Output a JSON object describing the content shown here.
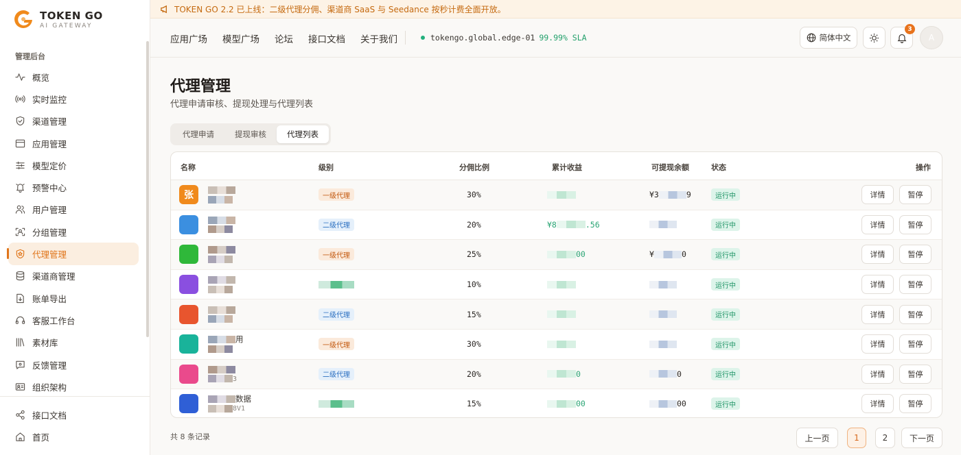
{
  "brand": {
    "title": "TOKEN GO",
    "subtitle": "AI GATEWAY"
  },
  "sidebar": {
    "section_label": "管理后台",
    "items": [
      {
        "label": "概览",
        "icon": "activity-icon"
      },
      {
        "label": "实时监控",
        "icon": "broadcast-icon"
      },
      {
        "label": "渠道管理",
        "icon": "shield-icon"
      },
      {
        "label": "应用管理",
        "icon": "window-icon"
      },
      {
        "label": "模型定价",
        "icon": "sliders-icon"
      },
      {
        "label": "预警中心",
        "icon": "bell-icon"
      },
      {
        "label": "用户管理",
        "icon": "users-icon"
      },
      {
        "label": "分组管理",
        "icon": "scan-user-icon"
      },
      {
        "label": "代理管理",
        "icon": "shield-star-icon",
        "active": true
      },
      {
        "label": "渠道商管理",
        "icon": "database-icon"
      },
      {
        "label": "账单导出",
        "icon": "file-download-icon"
      },
      {
        "label": "客服工作台",
        "icon": "headset-icon"
      },
      {
        "label": "素材库",
        "icon": "library-icon"
      },
      {
        "label": "反馈管理",
        "icon": "message-icon"
      },
      {
        "label": "组织架构",
        "icon": "id-card-icon"
      }
    ],
    "bottom_items": [
      {
        "label": "接口文档",
        "icon": "share-icon"
      },
      {
        "label": "首页",
        "icon": "home-icon"
      }
    ]
  },
  "banner": {
    "text": "TOKEN GO 2.2 已上线：二级代理分佣、渠道商 SaaS 与 Seedance 按秒计费全面开放。",
    "icon": "megaphone-icon"
  },
  "topbar": {
    "nav": [
      "应用广场",
      "模型广场",
      "论坛",
      "接口文档",
      "关于我们"
    ],
    "node": "tokengo.global.edge-01",
    "sla": "99.99% SLA",
    "lang": "简体中文",
    "notif_count": "3",
    "avatar_letter": "A"
  },
  "page": {
    "title": "代理管理",
    "subtitle": "代理申请审核、提现处理与代理列表"
  },
  "tabs": [
    {
      "label": "代理申请",
      "active": false
    },
    {
      "label": "提现审核",
      "active": false
    },
    {
      "label": "代理列表",
      "active": true
    }
  ],
  "table": {
    "headers": {
      "name": "名称",
      "level": "级别",
      "ratio": "分佣比例",
      "income": "累计收益",
      "balance": "可提现余额",
      "status": "状态",
      "ops": "操作"
    },
    "rows": [
      {
        "logo_char": "张",
        "logo_color": "#f08a1c",
        "name_tail": "",
        "sub": "",
        "level": "一级代理",
        "level_kind": "l1",
        "ratio": "30%",
        "income": "",
        "balance": "¥3",
        "balance_tail": "9",
        "status": "运行中"
      },
      {
        "logo_char": "",
        "logo_color": "#3b8fe0",
        "name_tail": "",
        "sub": "",
        "level": "二级代理",
        "level_kind": "l2",
        "ratio": "20%",
        "income": "¥8",
        "income_tail": ".56",
        "balance": "",
        "status": "运行中"
      },
      {
        "logo_char": "",
        "logo_color": "#2fb83a",
        "name_tail": "",
        "sub": "",
        "level": "一级代理",
        "level_kind": "l1",
        "ratio": "25%",
        "income": "",
        "income_tail": "00",
        "balance": "¥",
        "balance_tail": "0",
        "status": "运行中"
      },
      {
        "logo_char": "",
        "logo_color": "#8a4fe0",
        "name_tail": "",
        "sub": "",
        "level": "",
        "level_kind": "none",
        "ratio": "10%",
        "income": "",
        "balance": "",
        "status": "运行中"
      },
      {
        "logo_char": "",
        "logo_color": "#e8552e",
        "name_tail": "",
        "sub": "",
        "level": "二级代理",
        "level_kind": "l2",
        "ratio": "15%",
        "income": "",
        "balance": "",
        "status": "运行中"
      },
      {
        "logo_char": "",
        "logo_color": "#19b39a",
        "name_tail": "用",
        "sub": "",
        "level": "一级代理",
        "level_kind": "l1",
        "ratio": "30%",
        "income": "",
        "balance": "",
        "status": "运行中"
      },
      {
        "logo_char": "",
        "logo_color": "#ea4a8c",
        "name_tail": "",
        "sub": "3",
        "level": "二级代理",
        "level_kind": "l2",
        "ratio": "20%",
        "income": "",
        "income_tail": "0",
        "balance": "",
        "balance_tail": "0",
        "status": "运行中"
      },
      {
        "logo_char": "",
        "logo_color": "#2f5fd6",
        "name_tail": "数据",
        "sub": "8V1",
        "level": "",
        "level_kind": "none",
        "ratio": "15%",
        "income": "",
        "income_tail": "00",
        "balance": "",
        "balance_tail": "00",
        "status": "运行中"
      }
    ],
    "op_detail": "详情",
    "op_pause": "暂停"
  },
  "footer": {
    "total": "共 8 条记录",
    "prev": "上一页",
    "pages": [
      "1",
      "2"
    ],
    "next": "下一页",
    "current_page": "1"
  }
}
